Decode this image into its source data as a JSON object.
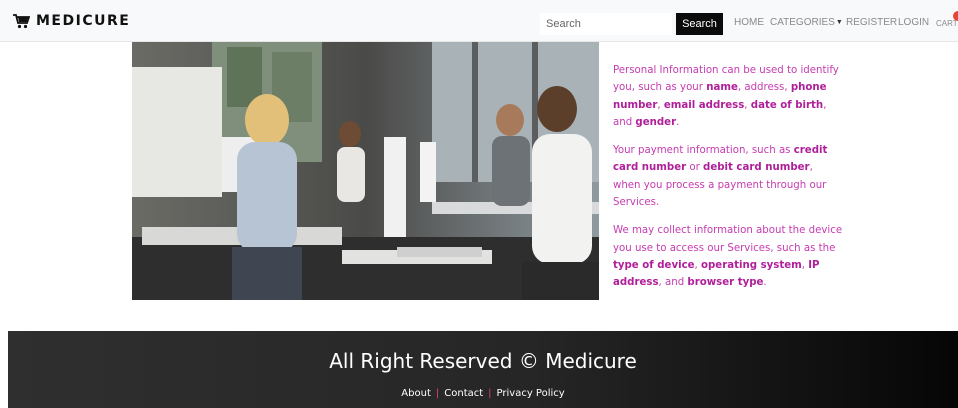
{
  "header": {
    "brand": "MEDICURE",
    "brand_icon": "shopping-cart-icon",
    "search": {
      "placeholder": "Search",
      "button_label": "Search"
    },
    "nav": {
      "home": "HOME",
      "categories": "CATEGORIES",
      "register": "REGISTER",
      "login": "LOGIN",
      "cart": "CART"
    },
    "colors": {
      "cart_badge": "#e8433a"
    }
  },
  "main": {
    "image": {
      "subject": "call-center agents with headsets working at computers"
    },
    "info": [
      {
        "segments": [
          {
            "text": "Personal Information can be used to identify you, such as your ",
            "bold": false
          },
          {
            "text": "name",
            "bold": true
          },
          {
            "text": ", address, ",
            "bold": false
          },
          {
            "text": "phone number",
            "bold": true
          },
          {
            "text": ", ",
            "bold": false
          },
          {
            "text": "email address",
            "bold": true
          },
          {
            "text": ", ",
            "bold": false
          },
          {
            "text": "date of birth",
            "bold": true
          },
          {
            "text": ", and ",
            "bold": false
          },
          {
            "text": "gender",
            "bold": true
          },
          {
            "text": ".",
            "bold": false
          }
        ]
      },
      {
        "segments": [
          {
            "text": "Your payment information, such as ",
            "bold": false
          },
          {
            "text": "credit card number",
            "bold": true
          },
          {
            "text": " or ",
            "bold": false
          },
          {
            "text": "debit card number",
            "bold": true
          },
          {
            "text": ", when you process a payment through our Services.",
            "bold": false
          }
        ]
      },
      {
        "segments": [
          {
            "text": "We may collect information about the device you use to access our Services, such as the ",
            "bold": false
          },
          {
            "text": "type of device",
            "bold": true
          },
          {
            "text": ", ",
            "bold": false
          },
          {
            "text": "operating system",
            "bold": true
          },
          {
            "text": ", ",
            "bold": false
          },
          {
            "text": "IP address",
            "bold": true
          },
          {
            "text": ", and ",
            "bold": false
          },
          {
            "text": "browser type",
            "bold": true
          },
          {
            "text": ".",
            "bold": false
          }
        ]
      }
    ],
    "colors": {
      "text": "#c63bb0",
      "bold_text": "#b01e9a"
    }
  },
  "footer": {
    "title": "All Right Reserved © Medicure",
    "links": {
      "about": "About",
      "contact": "Contact",
      "privacy": "Privacy Policy"
    },
    "separator": "|",
    "colors": {
      "separator": "#e0407b"
    }
  }
}
